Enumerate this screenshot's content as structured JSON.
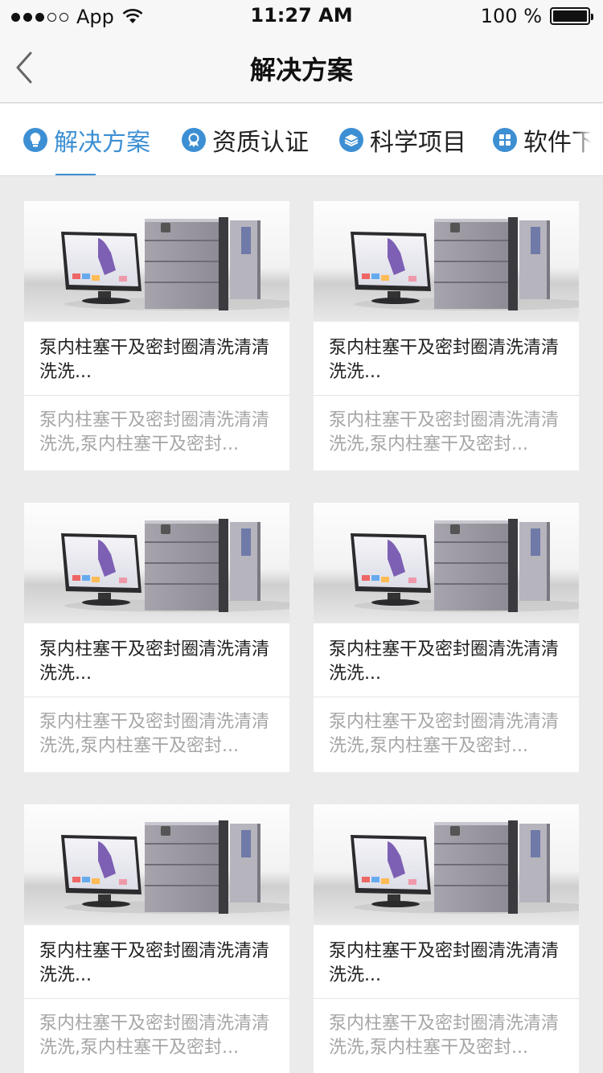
{
  "status_bar": {
    "carrier": "App",
    "time": "11:27 AM",
    "battery": "100 %"
  },
  "nav": {
    "title": "解决方案"
  },
  "tabs": [
    {
      "label": "解决方案",
      "icon": "bulb-icon"
    },
    {
      "label": "资质认证",
      "icon": "award-icon"
    },
    {
      "label": "科学项目",
      "icon": "layers-icon"
    },
    {
      "label": "软件下载",
      "icon": "apps-icon"
    }
  ],
  "cards": [
    {
      "title": "泵内柱塞干及密封圈清洗清清洗洗...",
      "desc": "泵内柱塞干及密封圈清洗清清洗洗,泵内柱塞干及密封..."
    },
    {
      "title": "泵内柱塞干及密封圈清洗清清洗洗...",
      "desc": "泵内柱塞干及密封圈清洗清清洗洗,泵内柱塞干及密封..."
    },
    {
      "title": "泵内柱塞干及密封圈清洗清清洗洗...",
      "desc": "泵内柱塞干及密封圈清洗清清洗洗,泵内柱塞干及密封..."
    },
    {
      "title": "泵内柱塞干及密封圈清洗清清洗洗...",
      "desc": "泵内柱塞干及密封圈清洗清清洗洗,泵内柱塞干及密封..."
    },
    {
      "title": "泵内柱塞干及密封圈清洗清清洗洗...",
      "desc": "泵内柱塞干及密封圈清洗清清洗洗,泵内柱塞干及密封..."
    },
    {
      "title": "泵内柱塞干及密封圈清洗清清洗洗...",
      "desc": "泵内柱塞干及密封圈清洗清清洗洗,泵内柱塞干及密封..."
    }
  ],
  "colors": {
    "accent": "#3d8fd3",
    "background": "#ebebeb",
    "desc_text": "#a6a6a6"
  }
}
